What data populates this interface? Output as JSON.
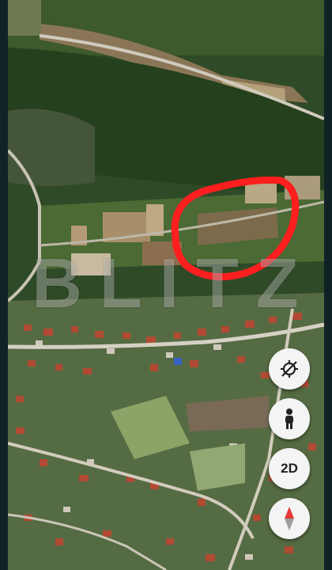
{
  "map": {
    "view": "satellite",
    "watermark_text": "BLITZ",
    "marker": {
      "shape": "freehand-ellipse",
      "color": "#ff1f1f"
    }
  },
  "controls": {
    "compass_off_icon": "location-off-icon",
    "street_view_icon": "pegman-icon",
    "view_mode_label": "2D",
    "compass_icon": "compass-icon"
  },
  "colors": {
    "frame": "#102226",
    "button_bg": "#f4f4f4",
    "highlight_ring": "#ff1f1f"
  }
}
